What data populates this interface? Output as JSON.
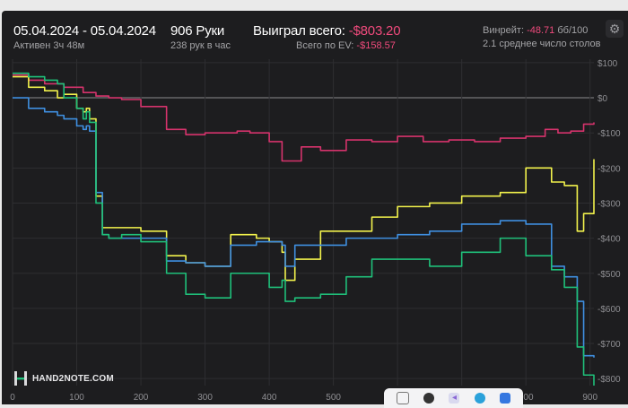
{
  "header": {
    "date_range": "05.04.2024 - 05.04.2024",
    "active_time": "Активен 3ч 48м",
    "hands": "906 Руки",
    "hands_per_hour": "238 рук в час",
    "won_label": "Выиграл всего:",
    "won_value": "-$803.20",
    "ev_label": "Всего по EV:",
    "ev_value": "-$158.57",
    "winrate_label": "Винрейт:",
    "winrate_value": "-48.71",
    "winrate_unit": "бб/100",
    "avg_tables": "2.1 среднее число столов"
  },
  "logo": {
    "text": "HAND2NOTE.COM"
  },
  "colors": {
    "background": "#1d1d1f",
    "negative": "#ef4a7c",
    "pink_series": "#d6336c",
    "yellow_series": "#f2f24c",
    "blue_series": "#3f8fe0",
    "green_series": "#1fc07a"
  },
  "taskbar": {
    "icons": [
      "file-icon",
      "chrome-icon",
      "vpn-icon",
      "telegram-icon",
      "app-icon"
    ]
  },
  "chart_data": {
    "type": "line",
    "xlim": [
      0,
      906
    ],
    "ylim": [
      -820,
      110
    ],
    "x_ticks": [
      0,
      100,
      200,
      300,
      400,
      500,
      600,
      700,
      800,
      900
    ],
    "y_ticks": [
      100,
      0,
      -100,
      -200,
      -300,
      -400,
      -500,
      -600,
      -700,
      -800
    ],
    "y_tick_labels": [
      "$100",
      "$0",
      "-$100",
      "-$200",
      "-$300",
      "-$400",
      "-$500",
      "-$600",
      "-$700",
      "-$800"
    ],
    "grid": true,
    "series": [
      {
        "color": "pink",
        "x": [
          0,
          25,
          50,
          80,
          110,
          130,
          150,
          170,
          200,
          240,
          270,
          300,
          350,
          370,
          400,
          420,
          450,
          480,
          520,
          560,
          600,
          640,
          680,
          720,
          760,
          800,
          830,
          850,
          870,
          890,
          906
        ],
        "y": [
          65,
          50,
          40,
          30,
          15,
          5,
          0,
          -5,
          -25,
          -90,
          -105,
          -100,
          -95,
          -100,
          -125,
          -180,
          -140,
          -150,
          -120,
          -125,
          -110,
          -125,
          -120,
          -125,
          -115,
          -110,
          -90,
          -100,
          -95,
          -75,
          -70
        ]
      },
      {
        "color": "yellow",
        "x": [
          0,
          25,
          50,
          70,
          80,
          100,
          110,
          115,
          120,
          130,
          140,
          150,
          170,
          200,
          240,
          270,
          300,
          340,
          380,
          400,
          420,
          425,
          440,
          480,
          520,
          560,
          600,
          650,
          700,
          760,
          800,
          840,
          860,
          880,
          890,
          906
        ],
        "y": [
          60,
          30,
          20,
          0,
          10,
          -30,
          -40,
          -30,
          -60,
          -280,
          -370,
          -370,
          -370,
          -380,
          -450,
          -470,
          -480,
          -390,
          -400,
          -410,
          -440,
          -520,
          -460,
          -380,
          -380,
          -340,
          -310,
          -300,
          -280,
          -270,
          -200,
          -240,
          -250,
          -380,
          -330,
          -175
        ]
      },
      {
        "color": "blue",
        "x": [
          0,
          25,
          50,
          70,
          80,
          100,
          110,
          115,
          120,
          130,
          140,
          150,
          170,
          200,
          240,
          270,
          300,
          340,
          380,
          400,
          420,
          425,
          440,
          480,
          520,
          560,
          600,
          650,
          700,
          760,
          800,
          840,
          860,
          880,
          890,
          906
        ],
        "y": [
          0,
          -30,
          -40,
          -50,
          -60,
          -80,
          -90,
          -80,
          -95,
          -270,
          -390,
          -400,
          -400,
          -400,
          -465,
          -470,
          -480,
          -420,
          -410,
          -410,
          -420,
          -480,
          -420,
          -420,
          -400,
          -400,
          -390,
          -380,
          -360,
          -350,
          -360,
          -480,
          -510,
          -580,
          -735,
          -740
        ]
      },
      {
        "color": "green",
        "x": [
          0,
          25,
          50,
          70,
          80,
          100,
          110,
          115,
          120,
          130,
          140,
          150,
          170,
          200,
          240,
          270,
          300,
          340,
          380,
          400,
          420,
          425,
          440,
          480,
          520,
          560,
          600,
          650,
          700,
          760,
          800,
          840,
          860,
          880,
          890,
          906
        ],
        "y": [
          70,
          60,
          50,
          40,
          0,
          -30,
          -60,
          -40,
          -70,
          -300,
          -390,
          -400,
          -390,
          -410,
          -500,
          -560,
          -570,
          -500,
          -500,
          -540,
          -520,
          -580,
          -570,
          -560,
          -510,
          -460,
          -460,
          -480,
          -440,
          -400,
          -450,
          -490,
          -540,
          -710,
          -790,
          -820
        ]
      }
    ]
  }
}
